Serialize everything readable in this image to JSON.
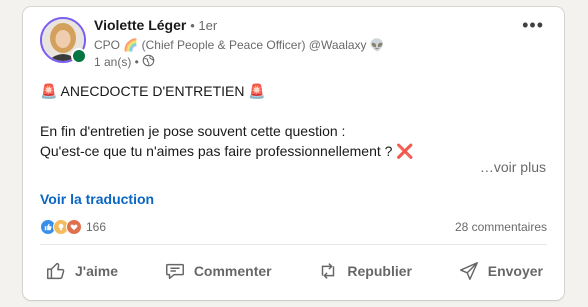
{
  "author": {
    "name": "Violette Léger",
    "degree": "• 1er",
    "headline": "CPO 🌈 (Chief People & Peace Officer) @Waalaxy 👽",
    "time": "1 an(s) •",
    "visibility_icon": "globe-icon"
  },
  "post": {
    "title_line": "🚨 ANECDOCTE D'ENTRETIEN 🚨",
    "line1": "En fin d'entretien je pose souvent cette question :",
    "line2": "Qu'est-ce que tu n'aimes pas faire professionnellement ? ❌",
    "see_more": "…voir plus",
    "translate": "Voir la traduction"
  },
  "social": {
    "reaction_count": "166",
    "comments": "28 commentaires"
  },
  "actions": {
    "like": "J'aime",
    "comment": "Commenter",
    "repost": "Republier",
    "send": "Envoyer"
  },
  "colors": {
    "link": "#0a66c2",
    "presence": "#057642",
    "avatar_ring": "#7a5df4"
  }
}
